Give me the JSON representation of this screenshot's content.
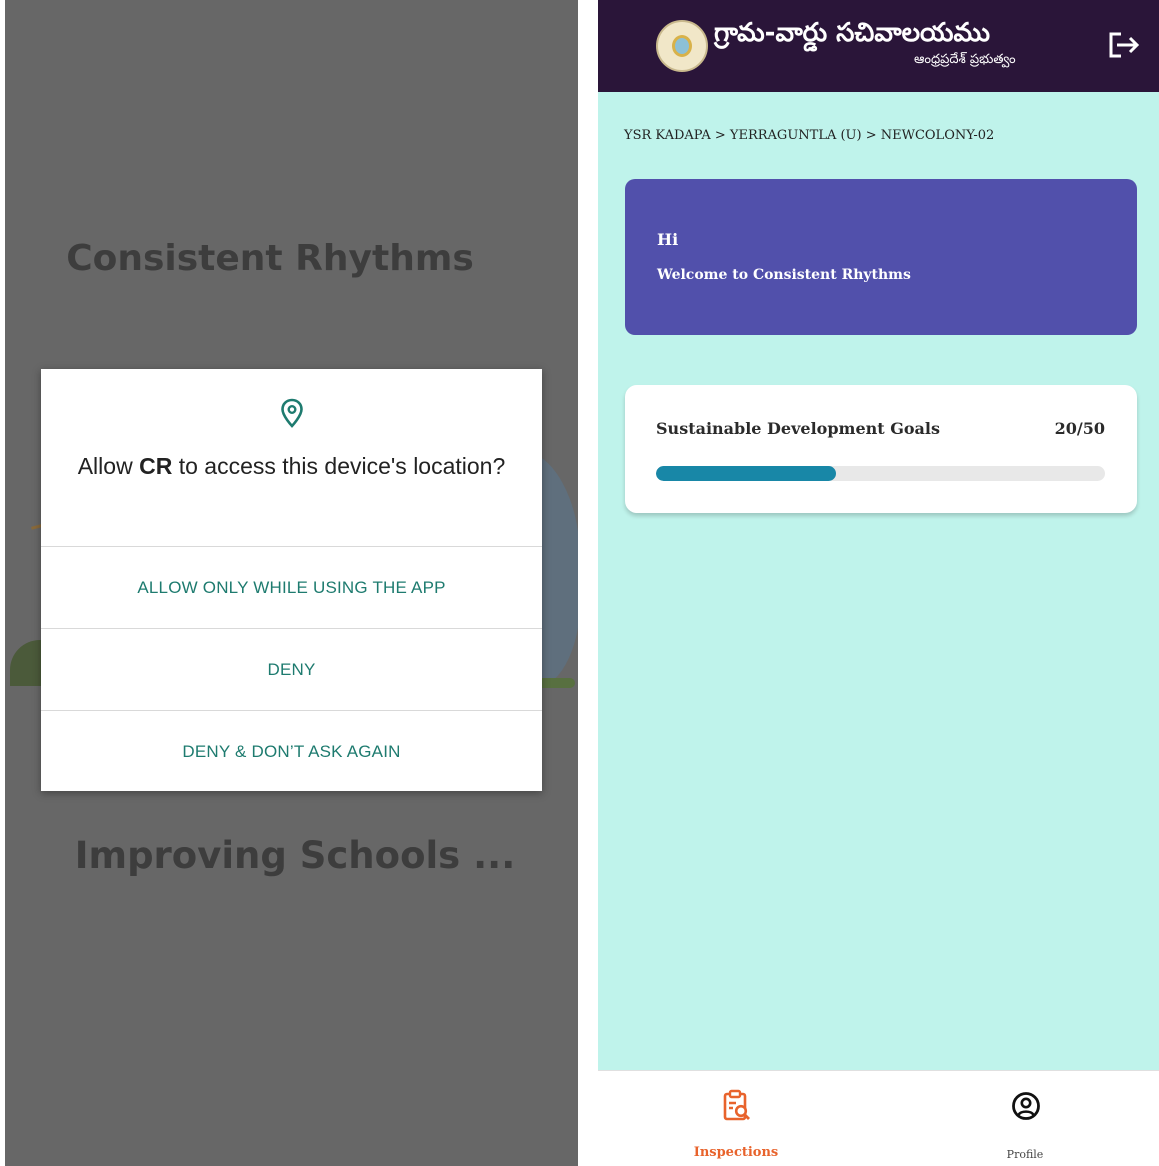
{
  "left_screen": {
    "app_title": "Consistent Rhythms",
    "bottom_title": "Improving Schools ...",
    "permission_dialog": {
      "question_prefix": "Allow ",
      "app_name": "CR",
      "question_suffix": " to access this device's location?",
      "options": [
        "ALLOW ONLY WHILE USING THE APP",
        "DENY",
        "DENY & DON’T ASK AGAIN"
      ],
      "accent_color": "#1e7b6f"
    }
  },
  "right_screen": {
    "header": {
      "brand_title": "గ్రామ-వార్డు సచివాలయము",
      "brand_subtitle": "ఆంధ్రప్రదేశ్ ప్రభుత్వం",
      "logo_icon": "ap-emblem-icon",
      "logout_icon": "logout-icon",
      "background_color": "#2a1539"
    },
    "breadcrumb": "YSR KADAPA > YERRAGUNTLA (U) > NEWCOLONY-02",
    "welcome_card": {
      "greeting": "Hi",
      "message": "Welcome to Consistent Rhythms",
      "background_color": "#5150ab"
    },
    "goal_card": {
      "title": "Sustainable Development Goals",
      "count_text": "20/50",
      "progress_fraction": 0.4,
      "bar_color": "#1887a7"
    },
    "bottom_nav": [
      {
        "label": "Inspections",
        "icon": "inspections-icon",
        "active": true,
        "color": "#e8632c"
      },
      {
        "label": "Profile",
        "icon": "profile-icon",
        "active": false
      }
    ],
    "background_color": "#bff3eb"
  }
}
